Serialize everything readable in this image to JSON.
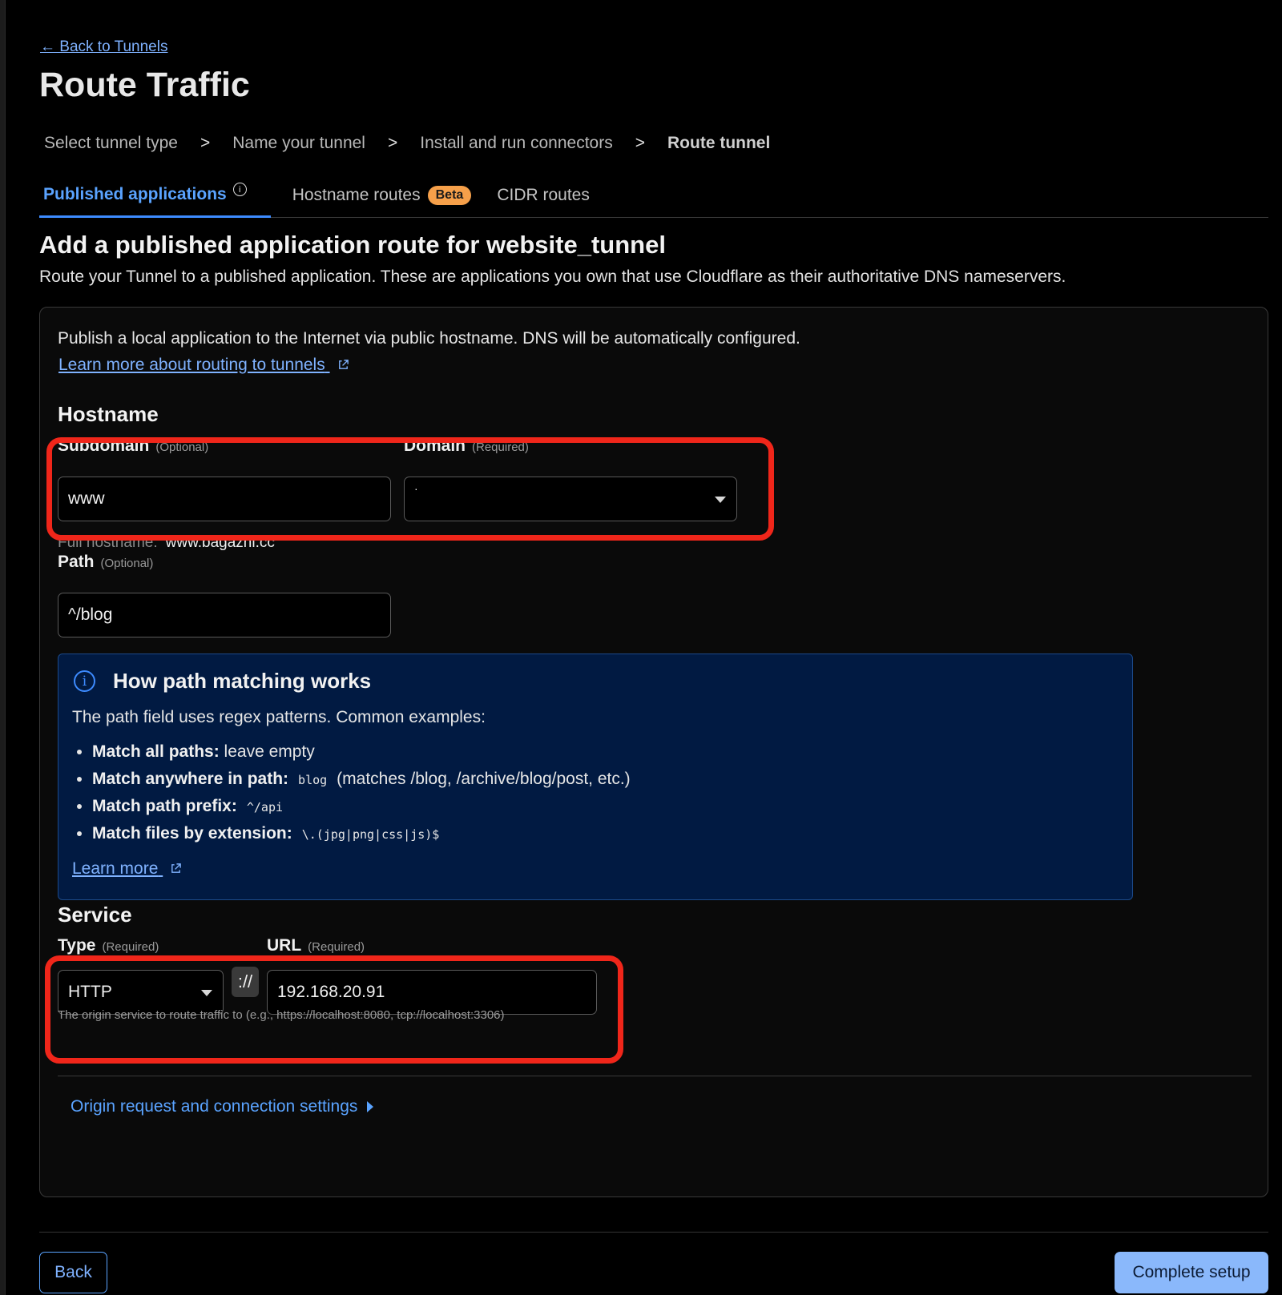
{
  "nav": {
    "back_link": "← Back to Tunnels"
  },
  "page": {
    "title": "Route Traffic"
  },
  "steps": [
    {
      "label": "Select tunnel type"
    },
    {
      "label": "Name your tunnel"
    },
    {
      "label": "Install and run connectors"
    },
    {
      "label": "Route tunnel"
    }
  ],
  "step_separator": ">",
  "tabs": {
    "published": {
      "label": "Published applications",
      "info_icon": "i"
    },
    "hostname": {
      "label": "Hostname routes",
      "badge": "Beta"
    },
    "cidr": {
      "label": "CIDR routes"
    }
  },
  "section": {
    "heading": "Add a published application route for website_tunnel",
    "description": "Route your Tunnel to a published application. These are applications you own that use Cloudflare as their authoritative DNS nameservers."
  },
  "card": {
    "intro": "Publish a local application to the Internet via public hostname. DNS will be automatically configured.",
    "learn_link": "Learn more about routing to tunnels"
  },
  "hostname": {
    "title": "Hostname",
    "subdomain_label": "Subdomain",
    "subdomain_hint": "(Optional)",
    "subdomain_value": "www",
    "domain_label": "Domain",
    "domain_hint": "(Required)",
    "domain_value": "·",
    "full_hostname_label": "Full hostname:",
    "full_hostname_value": "www.bagazhi.cc",
    "path_label": "Path",
    "path_hint": "(Optional)",
    "path_value": "^/blog"
  },
  "callout": {
    "icon": "i",
    "title": "How path matching works",
    "description": "The path field uses regex patterns. Common examples:",
    "items": [
      {
        "bold": "Match all paths:",
        "text": "leave empty",
        "code": ""
      },
      {
        "bold": "Match anywhere in path:",
        "code": "blog",
        "text": "(matches /blog, /archive/blog/post, etc.)"
      },
      {
        "bold": "Match path prefix:",
        "code": "^/api",
        "text": ""
      },
      {
        "bold": "Match files by extension:",
        "code": "\\.(jpg|png|css|js)$",
        "text": ""
      }
    ],
    "learn_link": "Learn more"
  },
  "service": {
    "title": "Service",
    "type_label": "Type",
    "type_hint": "(Required)",
    "type_value": "HTTP",
    "separator": "://",
    "url_label": "URL",
    "url_hint": "(Required)",
    "url_value": "192.168.20.91",
    "url_help": "The origin service to route traffic to (e.g., https://localhost:8080, tcp://localhost:3306)"
  },
  "origin_settings": {
    "label": "Origin request and connection settings"
  },
  "footer": {
    "back": "Back",
    "complete": "Complete setup"
  },
  "colors": {
    "accent": "#3d8bff",
    "highlight": "#f0261a",
    "badge": "#f6a04a",
    "primary_button": "#8ab8fb"
  }
}
